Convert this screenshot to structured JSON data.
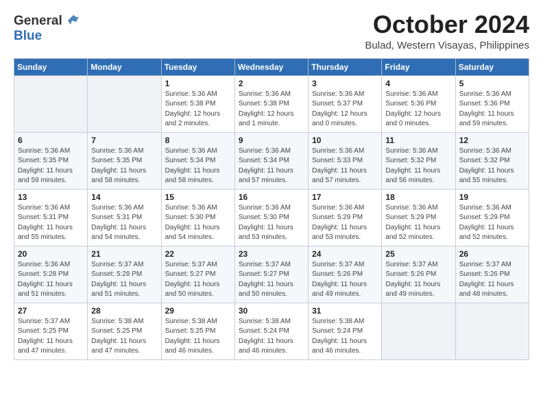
{
  "header": {
    "logo_general": "General",
    "logo_blue": "Blue",
    "month_title": "October 2024",
    "location": "Bulad, Western Visayas, Philippines"
  },
  "calendar": {
    "days_of_week": [
      "Sunday",
      "Monday",
      "Tuesday",
      "Wednesday",
      "Thursday",
      "Friday",
      "Saturday"
    ],
    "weeks": [
      [
        {
          "day": "",
          "content": ""
        },
        {
          "day": "",
          "content": ""
        },
        {
          "day": "1",
          "content": "Sunrise: 5:36 AM\nSunset: 5:38 PM\nDaylight: 12 hours\nand 2 minutes."
        },
        {
          "day": "2",
          "content": "Sunrise: 5:36 AM\nSunset: 5:38 PM\nDaylight: 12 hours\nand 1 minute."
        },
        {
          "day": "3",
          "content": "Sunrise: 5:36 AM\nSunset: 5:37 PM\nDaylight: 12 hours\nand 0 minutes."
        },
        {
          "day": "4",
          "content": "Sunrise: 5:36 AM\nSunset: 5:36 PM\nDaylight: 12 hours\nand 0 minutes."
        },
        {
          "day": "5",
          "content": "Sunrise: 5:36 AM\nSunset: 5:36 PM\nDaylight: 11 hours\nand 59 minutes."
        }
      ],
      [
        {
          "day": "6",
          "content": "Sunrise: 5:36 AM\nSunset: 5:35 PM\nDaylight: 11 hours\nand 59 minutes."
        },
        {
          "day": "7",
          "content": "Sunrise: 5:36 AM\nSunset: 5:35 PM\nDaylight: 11 hours\nand 58 minutes."
        },
        {
          "day": "8",
          "content": "Sunrise: 5:36 AM\nSunset: 5:34 PM\nDaylight: 11 hours\nand 58 minutes."
        },
        {
          "day": "9",
          "content": "Sunrise: 5:36 AM\nSunset: 5:34 PM\nDaylight: 11 hours\nand 57 minutes."
        },
        {
          "day": "10",
          "content": "Sunrise: 5:36 AM\nSunset: 5:33 PM\nDaylight: 11 hours\nand 57 minutes."
        },
        {
          "day": "11",
          "content": "Sunrise: 5:36 AM\nSunset: 5:32 PM\nDaylight: 11 hours\nand 56 minutes."
        },
        {
          "day": "12",
          "content": "Sunrise: 5:36 AM\nSunset: 5:32 PM\nDaylight: 11 hours\nand 55 minutes."
        }
      ],
      [
        {
          "day": "13",
          "content": "Sunrise: 5:36 AM\nSunset: 5:31 PM\nDaylight: 11 hours\nand 55 minutes."
        },
        {
          "day": "14",
          "content": "Sunrise: 5:36 AM\nSunset: 5:31 PM\nDaylight: 11 hours\nand 54 minutes."
        },
        {
          "day": "15",
          "content": "Sunrise: 5:36 AM\nSunset: 5:30 PM\nDaylight: 11 hours\nand 54 minutes."
        },
        {
          "day": "16",
          "content": "Sunrise: 5:36 AM\nSunset: 5:30 PM\nDaylight: 11 hours\nand 53 minutes."
        },
        {
          "day": "17",
          "content": "Sunrise: 5:36 AM\nSunset: 5:29 PM\nDaylight: 11 hours\nand 53 minutes."
        },
        {
          "day": "18",
          "content": "Sunrise: 5:36 AM\nSunset: 5:29 PM\nDaylight: 11 hours\nand 52 minutes."
        },
        {
          "day": "19",
          "content": "Sunrise: 5:36 AM\nSunset: 5:29 PM\nDaylight: 11 hours\nand 52 minutes."
        }
      ],
      [
        {
          "day": "20",
          "content": "Sunrise: 5:36 AM\nSunset: 5:28 PM\nDaylight: 11 hours\nand 51 minutes."
        },
        {
          "day": "21",
          "content": "Sunrise: 5:37 AM\nSunset: 5:28 PM\nDaylight: 11 hours\nand 51 minutes."
        },
        {
          "day": "22",
          "content": "Sunrise: 5:37 AM\nSunset: 5:27 PM\nDaylight: 11 hours\nand 50 minutes."
        },
        {
          "day": "23",
          "content": "Sunrise: 5:37 AM\nSunset: 5:27 PM\nDaylight: 11 hours\nand 50 minutes."
        },
        {
          "day": "24",
          "content": "Sunrise: 5:37 AM\nSunset: 5:26 PM\nDaylight: 11 hours\nand 49 minutes."
        },
        {
          "day": "25",
          "content": "Sunrise: 5:37 AM\nSunset: 5:26 PM\nDaylight: 11 hours\nand 49 minutes."
        },
        {
          "day": "26",
          "content": "Sunrise: 5:37 AM\nSunset: 5:26 PM\nDaylight: 11 hours\nand 48 minutes."
        }
      ],
      [
        {
          "day": "27",
          "content": "Sunrise: 5:37 AM\nSunset: 5:25 PM\nDaylight: 11 hours\nand 47 minutes."
        },
        {
          "day": "28",
          "content": "Sunrise: 5:38 AM\nSunset: 5:25 PM\nDaylight: 11 hours\nand 47 minutes."
        },
        {
          "day": "29",
          "content": "Sunrise: 5:38 AM\nSunset: 5:25 PM\nDaylight: 11 hours\nand 46 minutes."
        },
        {
          "day": "30",
          "content": "Sunrise: 5:38 AM\nSunset: 5:24 PM\nDaylight: 11 hours\nand 46 minutes."
        },
        {
          "day": "31",
          "content": "Sunrise: 5:38 AM\nSunset: 5:24 PM\nDaylight: 11 hours\nand 46 minutes."
        },
        {
          "day": "",
          "content": ""
        },
        {
          "day": "",
          "content": ""
        }
      ]
    ]
  }
}
